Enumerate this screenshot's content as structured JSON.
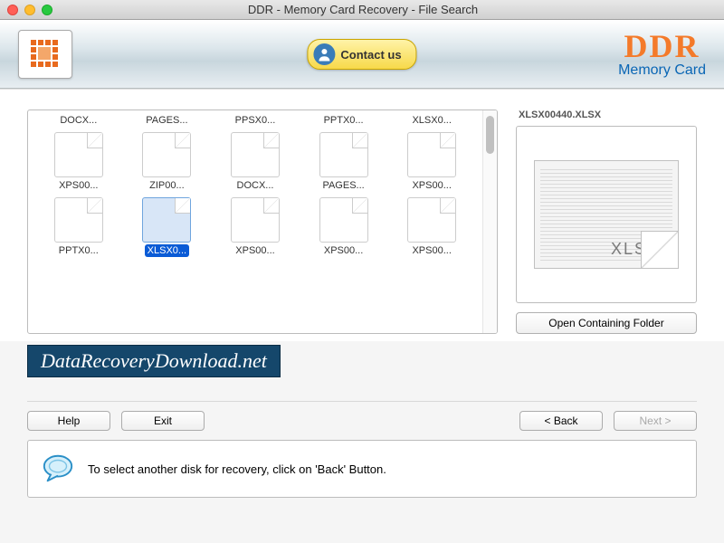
{
  "window": {
    "title": "DDR - Memory Card Recovery - File Search"
  },
  "header": {
    "contact_label": "Contact us",
    "brand_top": "DDR",
    "brand_sub": "Memory Card"
  },
  "files": {
    "items": [
      {
        "label": "DOCX...",
        "partial": true
      },
      {
        "label": "PAGES...",
        "partial": true
      },
      {
        "label": "PPSX0...",
        "partial": true
      },
      {
        "label": "PPTX0...",
        "partial": true
      },
      {
        "label": "XLSX0...",
        "partial": true
      },
      {
        "label": "XPS00..."
      },
      {
        "label": "ZIP00..."
      },
      {
        "label": "DOCX..."
      },
      {
        "label": "PAGES..."
      },
      {
        "label": "XPS00..."
      },
      {
        "label": "PPTX0..."
      },
      {
        "label": "XLSX0...",
        "selected": true
      },
      {
        "label": "XPS00..."
      },
      {
        "label": "XPS00..."
      },
      {
        "label": "XPS00..."
      }
    ]
  },
  "preview": {
    "filename": "XLSX00440.XLSX",
    "ext": "XLSX",
    "open_folder_label": "Open Containing Folder"
  },
  "banner": {
    "text": "DataRecoveryDownload.net"
  },
  "buttons": {
    "help": "Help",
    "exit": "Exit",
    "back": "< Back",
    "next": "Next >"
  },
  "hint": {
    "text": "To select another disk for recovery, click on 'Back' Button."
  }
}
